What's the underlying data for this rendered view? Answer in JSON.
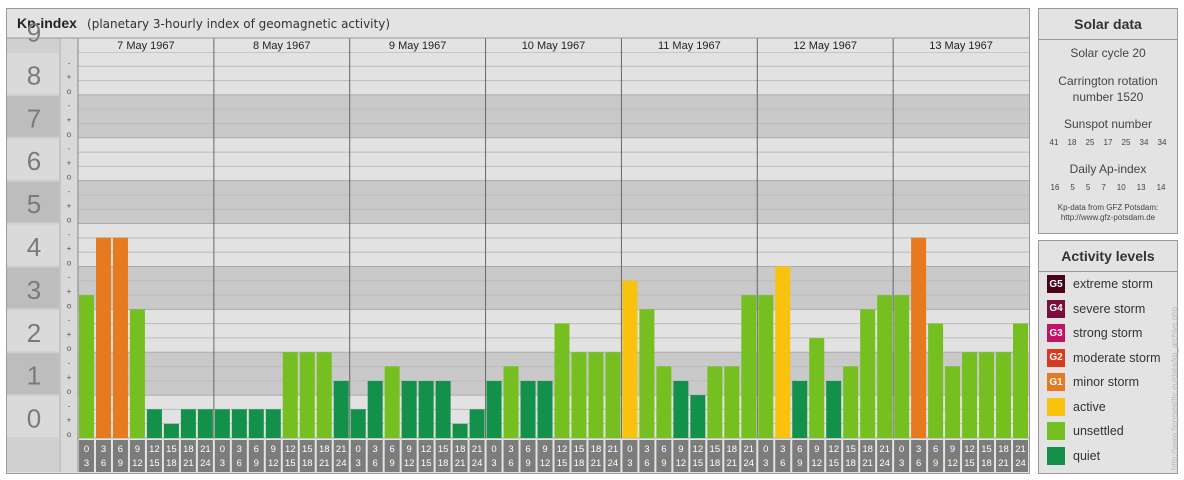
{
  "header": {
    "title": "Kp-index",
    "subtitle": "(planetary 3-hourly index of geomagnetic activity)"
  },
  "chart_data": {
    "type": "bar",
    "y_ticks": [
      "0",
      "1",
      "2",
      "3",
      "4",
      "5",
      "6",
      "7",
      "8",
      "9"
    ],
    "y_minor_labels": [
      "o",
      "+",
      "-"
    ],
    "ylim": [
      0,
      9
    ],
    "days": [
      "7 May 1967",
      "8 May 1967",
      "9 May 1967",
      "10 May 1967",
      "11 May 1967",
      "12 May 1967",
      "13 May 1967"
    ],
    "hour_starts": [
      "0",
      "3",
      "6",
      "9",
      "12",
      "15",
      "18",
      "21"
    ],
    "hour_ends": [
      "3",
      "6",
      "9",
      "12",
      "15",
      "18",
      "21",
      "24"
    ],
    "values": [
      [
        3.33,
        4.67,
        4.67,
        3.0,
        0.67,
        0.33,
        0.67,
        0.67
      ],
      [
        0.67,
        0.67,
        0.67,
        0.67,
        2.0,
        2.0,
        2.0,
        1.33
      ],
      [
        0.67,
        1.33,
        1.67,
        1.33,
        1.33,
        1.33,
        0.33,
        0.67
      ],
      [
        1.33,
        1.67,
        1.33,
        1.33,
        2.67,
        2.0,
        2.0,
        2.0
      ],
      [
        3.67,
        3.0,
        1.67,
        1.33,
        1.0,
        1.67,
        1.67,
        3.33
      ],
      [
        3.33,
        4.0,
        1.33,
        2.33,
        1.33,
        1.67,
        3.0,
        3.33
      ],
      [
        3.33,
        4.67,
        2.67,
        1.67,
        2.0,
        2.0,
        2.0,
        2.67
      ]
    ],
    "level_colors": {
      "quiet": "#13904a",
      "unsettled": "#76bf21",
      "active": "#f9c20c",
      "G1": "#e7791f",
      "G2": "#d73a1c",
      "G3": "#c21263",
      "G4": "#7a0d3c",
      "G5": "#4a0218"
    },
    "grid": true
  },
  "solar": {
    "title": "Solar data",
    "cycle_label": "Solar cycle 20",
    "carrington_line1": "Carrington rotation",
    "carrington_line2": "number 1520",
    "sunspot_title": "Sunspot number",
    "sunspot_values": [
      "41",
      "18",
      "25",
      "17",
      "25",
      "34",
      "34"
    ],
    "ap_title": "Daily Ap-index",
    "ap_values": [
      "16",
      "5",
      "5",
      "7",
      "10",
      "13",
      "14"
    ],
    "source_line1": "Kp-data from  GFZ Potsdam:",
    "source_line2": "http://www.gfz-potsdam.de"
  },
  "activity": {
    "title": "Activity levels",
    "levels": [
      {
        "code": "G5",
        "label": "extreme storm",
        "color": "#4a0218"
      },
      {
        "code": "G4",
        "label": "severe storm",
        "color": "#7a0d3c"
      },
      {
        "code": "G3",
        "label": "strong storm",
        "color": "#c21263"
      },
      {
        "code": "G2",
        "label": "moderate storm",
        "color": "#d73a1c"
      },
      {
        "code": "G1",
        "label": "minor storm",
        "color": "#e7791f"
      },
      {
        "code": "",
        "label": "active",
        "color": "#f9c20c"
      },
      {
        "code": "",
        "label": "unsettled",
        "color": "#76bf21"
      },
      {
        "code": "",
        "label": "quiet",
        "color": "#13904a"
      }
    ]
  },
  "watermark": "http://www.fieryseattle.eu/data/kp_archive.php"
}
